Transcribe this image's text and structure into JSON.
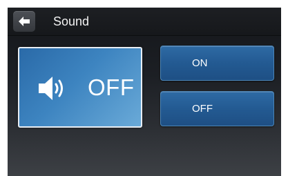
{
  "header": {
    "title": "Sound",
    "back_icon": "back-arrow-icon"
  },
  "status": {
    "icon": "speaker-volume-icon",
    "label": "OFF"
  },
  "options": {
    "on_label": "ON",
    "off_label": "OFF"
  },
  "colors": {
    "accent_blue": "#235a92",
    "panel_blue": "#3d84c0",
    "background": "#1c1f24",
    "text": "#ffffff"
  }
}
